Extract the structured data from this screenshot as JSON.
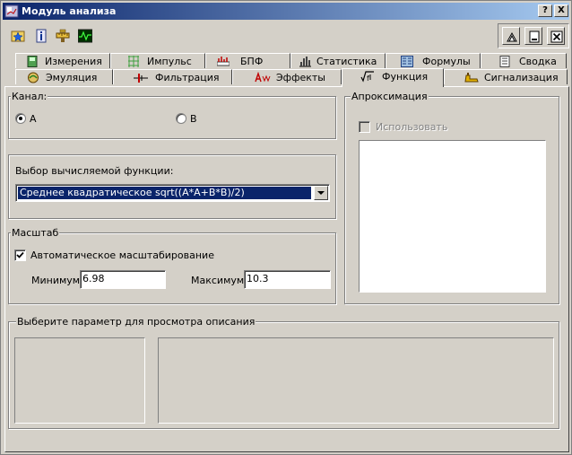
{
  "window": {
    "title": "Модуль анализа",
    "help_glyph": "?",
    "close_glyph": "X"
  },
  "toolbar": {
    "icons": [
      "star-folder-icon",
      "info-icon",
      "ruler-icon",
      "oscilloscope-icon"
    ]
  },
  "tabs_row1": [
    {
      "label": "Измерения",
      "icon": "measure-icon"
    },
    {
      "label": "Импульс",
      "icon": "pulse-icon"
    },
    {
      "label": "БПФ",
      "icon": "fft-icon"
    },
    {
      "label": "Статистика",
      "icon": "statistics-icon"
    },
    {
      "label": "Формулы",
      "icon": "formula-icon"
    },
    {
      "label": "Сводка",
      "icon": "summary-icon"
    }
  ],
  "tabs_row2": [
    {
      "label": "Эмуляция",
      "icon": "emulation-icon"
    },
    {
      "label": "Фильтрация",
      "icon": "filter-icon"
    },
    {
      "label": "Эффекты",
      "icon": "effects-icon"
    },
    {
      "label": "Функция",
      "icon": "function-icon",
      "active": true
    },
    {
      "label": "Сигнализация",
      "icon": "alarm-icon"
    }
  ],
  "channel": {
    "legend": "Канал:",
    "options": [
      "A",
      "B"
    ],
    "selected": "A"
  },
  "function_select": {
    "legend": "Выбор вычисляемой функции:",
    "value": "Среднее квадратическое sqrt((A*A+B*B)/2)"
  },
  "scale": {
    "legend": "Масштаб",
    "auto_label": "Автоматическое масштабирование",
    "auto_checked": true,
    "min_label": "Минимум",
    "min_value": "6.98",
    "max_label": "Максимум",
    "max_value": "10.3"
  },
  "approximation": {
    "legend": "Апроксимация",
    "use_label": "Использовать",
    "use_checked": false,
    "use_enabled": false
  },
  "description": {
    "legend": "Выберите параметр для просмотра описания"
  },
  "colors": {
    "titlebar_start": "#0a246a",
    "titlebar_end": "#a6caf0",
    "face": "#d4d0c8",
    "selection": "#0a246a"
  }
}
